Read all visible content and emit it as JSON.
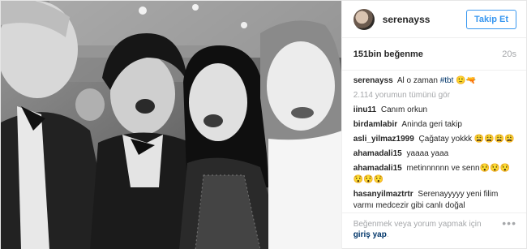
{
  "post": {
    "username": "serenayss",
    "follow_label": "Takip Et",
    "likes": "151bin beğenme",
    "time": "20s",
    "caption": {
      "user": "serenayss",
      "text": "Al o zaman ",
      "tag": "#tbt",
      "emoji": " 🙂🔫"
    },
    "view_all": "2.114 yorumun tümünü gör",
    "comments": [
      {
        "user": "iinu11",
        "text": "Canım orkun"
      },
      {
        "user": "birdamlabir",
        "text": "Aninda geri takip"
      },
      {
        "user": "asli_yilmaz1999",
        "text": "Çağatay yokkk 😩😩😩😩"
      },
      {
        "user": "ahamadali15",
        "text": "yaaaa yaaa"
      },
      {
        "user": "ahamadali15",
        "text": "metinnnnnn ve senn😯😯😯😯😯😯"
      },
      {
        "user": "hasanyilmaztrtr",
        "text": "Serenayyyyy yeni filim varmı medcezir gibi canlı doğal"
      }
    ],
    "footer": {
      "text": "Beğenmek veya yorum yapmak için",
      "login": "giriş yap",
      "period": ".",
      "more": "•••"
    }
  },
  "icons": {
    "avatar": "profile-avatar",
    "more": "more-options-icon"
  },
  "colors": {
    "accent": "#3897f0",
    "link": "#003569",
    "muted": "#a5a7aa"
  }
}
